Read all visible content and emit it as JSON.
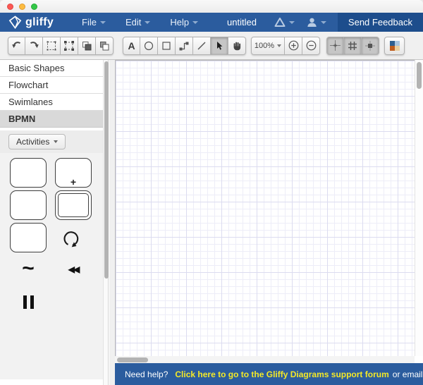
{
  "menubar": {
    "logo_text": "gliffy",
    "menus": [
      {
        "label": "File"
      },
      {
        "label": "Edit"
      },
      {
        "label": "Help"
      }
    ],
    "document_title": "untitled",
    "send_feedback": "Send Feedback"
  },
  "toolbar": {
    "text_tool": "A",
    "zoom_level": "100%"
  },
  "sidebar": {
    "sections": [
      {
        "label": "Basic Shapes"
      },
      {
        "label": "Flowchart"
      },
      {
        "label": "Swimlanes"
      },
      {
        "label": "BPMN"
      }
    ],
    "active_section": "BPMN",
    "category_dropdown_label": "Activities",
    "markers": {
      "subprocess_plus": "+",
      "adhoc": "~",
      "compensation": "◀◀"
    }
  },
  "footer": {
    "prompt": "Need help?",
    "link": "Click here to go to the Gliffy Diagrams support forum",
    "suffix": "or email support@gliffy.com"
  },
  "colors": {
    "menubar_blue": "#2b5c9e",
    "send_feedback_blue": "#1d4d8c",
    "footer_blue": "#2b5c9e",
    "link_yellow": "#f4e928",
    "traffic_red": "#fc5753",
    "traffic_yellow": "#fdbc40",
    "traffic_green": "#33c748",
    "theme_swatch_1": "#2e5f8f",
    "theme_swatch_2": "#aac6e0",
    "theme_swatch_3": "#bf5c1c",
    "theme_swatch_4": "#e9cfa0"
  }
}
